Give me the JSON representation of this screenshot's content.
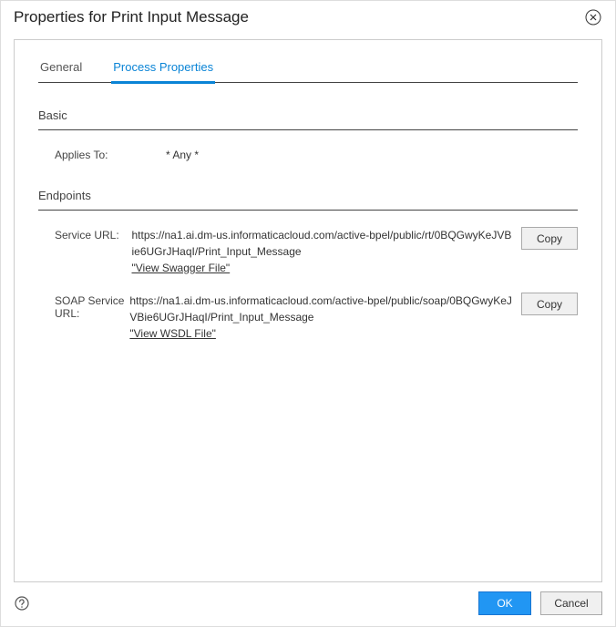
{
  "title": "Properties for Print Input Message",
  "tabs": {
    "general": "General",
    "process_properties": "Process Properties"
  },
  "sections": {
    "basic": {
      "header": "Basic",
      "applies_to": {
        "label": "Applies To:",
        "value": "* Any *"
      }
    },
    "endpoints": {
      "header": "Endpoints",
      "service_url": {
        "label": "Service URL:",
        "value": "https://na1.ai.dm-us.informaticacloud.com/active-bpel/public/rt/0BQGwyKeJVBie6UGrJHaqI/Print_Input_Message",
        "link": "\"View Swagger File\"",
        "copy": "Copy"
      },
      "soap_service_url": {
        "label": "SOAP Service URL:",
        "value": "https://na1.ai.dm-us.informaticacloud.com/active-bpel/public/soap/0BQGwyKeJVBie6UGrJHaqI/Print_Input_Message",
        "link": "\"View WSDL File\"",
        "copy": "Copy"
      }
    }
  },
  "footer": {
    "ok": "OK",
    "cancel": "Cancel"
  }
}
